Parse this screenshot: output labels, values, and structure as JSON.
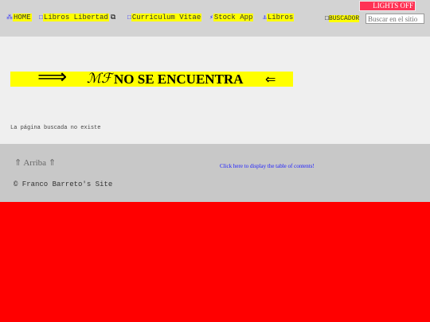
{
  "nav": {
    "items": [
      {
        "icon": "⁂",
        "label": "HOME"
      },
      {
        "icon": "□",
        "label": "Libros Libertad",
        "icon_after": "⧉"
      },
      {
        "icon": "□",
        "label": "Curriculum Vitae"
      },
      {
        "icon": "⚡",
        "label": "Stock App"
      },
      {
        "icon": "⚓",
        "label": "Libros"
      }
    ]
  },
  "header": {
    "lights_label": "LIGHTS OFF",
    "buscador_icon": "□",
    "buscador_label": "BUSCADOR",
    "search_placeholder": "Buscar en el sitio"
  },
  "main": {
    "arrow_right": "⟹",
    "logo_glyph": "ℳℱ",
    "title": "NO SE ENCUENTRA",
    "arrow_left": "⇐",
    "message": "La página buscada no existe"
  },
  "footer": {
    "arriba": "⇑ Arriba ⇑",
    "toc_link": "Click here to display the table of contents!",
    "copyright": "© Franco Barreto's Site"
  },
  "colors": {
    "highlight": "#ffff00",
    "page_background": "#ff0000",
    "link": "#1a1aff",
    "lights_button": "#ff3355"
  }
}
